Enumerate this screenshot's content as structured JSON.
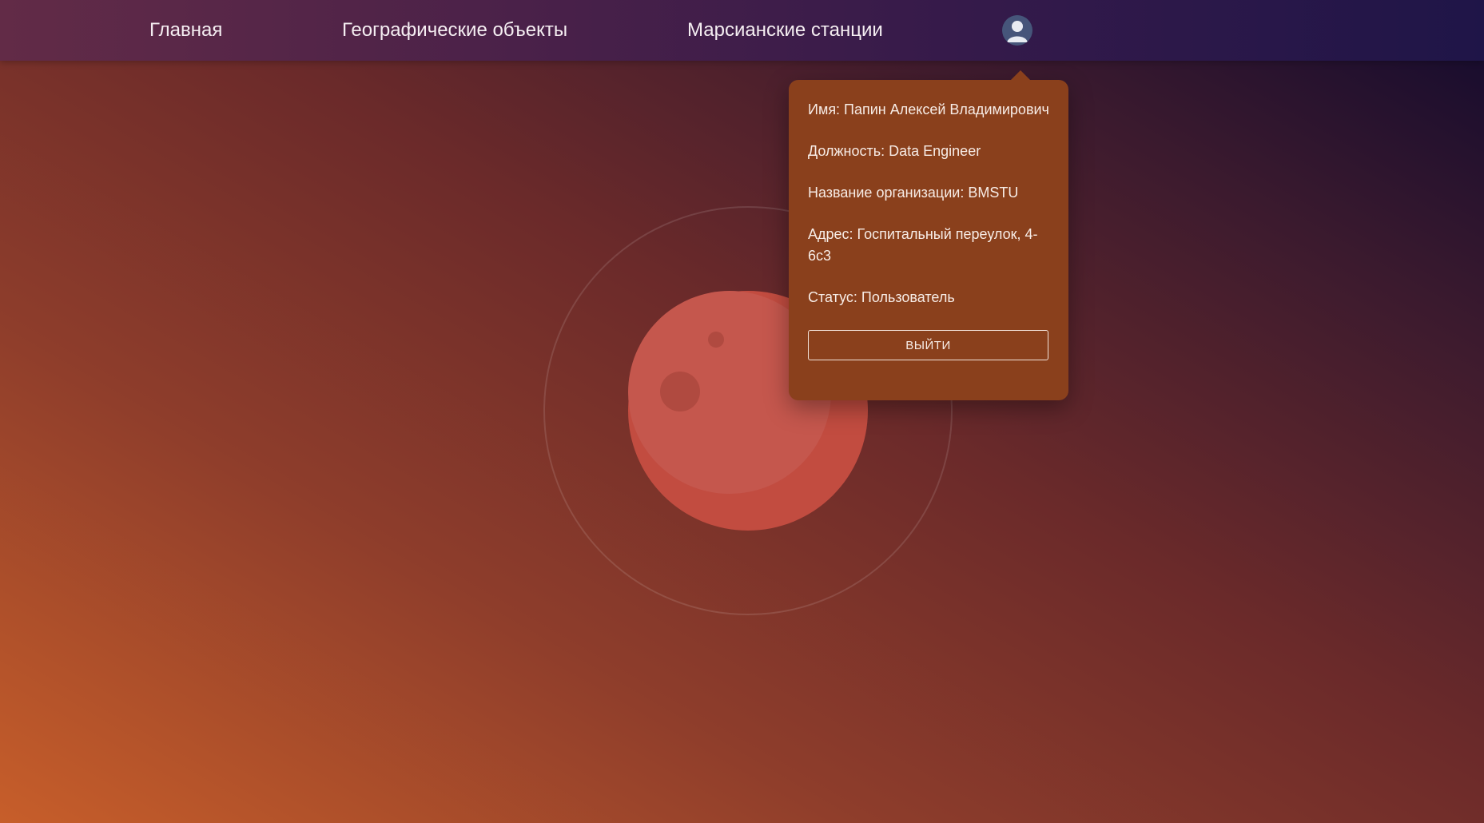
{
  "nav": {
    "home_label": "Главная",
    "geo_label": "Географические объекты",
    "stations_label": "Марсианские станции"
  },
  "profile": {
    "name": "Имя: Папин Алексей Владимирович",
    "position": "Должность: Data Engineer",
    "organization": "Название организации: BMSTU",
    "address": "Адрес: Госпитальный переулок, 4-6с3",
    "status": "Статус: Пользователь",
    "logout_label": "ВЫЙТИ"
  },
  "icons": {
    "avatar": "user-avatar-icon",
    "planet": "mars-planet-illustration"
  },
  "colors": {
    "navbar_start": "#622b47",
    "navbar_end": "#1f1548",
    "popup_bg": "#8a401c",
    "planet": "#c5534a"
  }
}
